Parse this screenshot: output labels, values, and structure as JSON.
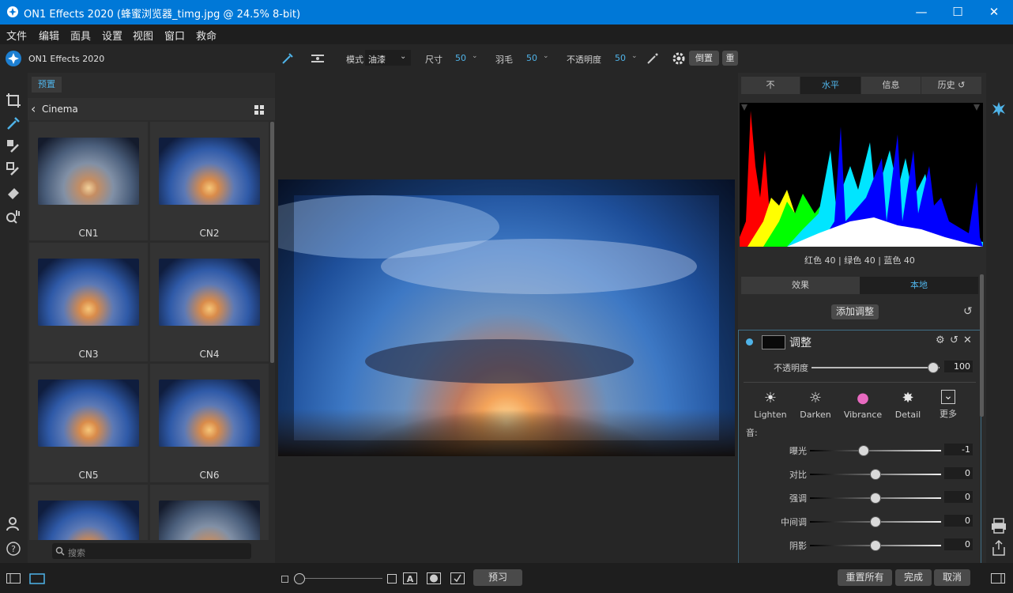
{
  "window": {
    "title": "ON1 Effects 2020 (蜂蜜浏览器_timg.jpg @ 24.5% 8-bit)",
    "minimize": "—",
    "maximize": "☐",
    "close": "✕"
  },
  "menubar": [
    "文件",
    "编辑",
    "面具",
    "设置",
    "视图",
    "窗口",
    "救命"
  ],
  "app_name": "ON1 Effects 2020",
  "toolbar": {
    "mode_label": "模式",
    "mode_value": "油漆",
    "size_label": "尺寸",
    "size_value": "50",
    "feather_label": "羽毛",
    "feather_value": "50",
    "opacity_label": "不透明度",
    "opacity_value": "50",
    "invert_button": "倒置",
    "extra_button": "重"
  },
  "left_panel": {
    "tab": "预置",
    "breadcrumb": "Cinema",
    "thumbnails": [
      "CN1",
      "CN2",
      "CN3",
      "CN4",
      "CN5",
      "CN6"
    ],
    "search_placeholder": "搜索"
  },
  "right_panel": {
    "tabs": [
      "不",
      "水平",
      "信息",
      "历史 ↺"
    ],
    "active_tab": 1,
    "rgb_readout": "红色   40  | 绿色   40  | 蓝色   40",
    "sub_tabs": [
      "效果",
      "本地"
    ],
    "active_sub_tab": 1,
    "add_adjust_button": "添加调整",
    "adjust": {
      "title": "调整",
      "opacity_label": "不透明度",
      "opacity_value": "100",
      "opacity_fraction": 0.95,
      "presets": [
        {
          "icon": "lighten-sun-icon",
          "glyph": "☀",
          "label": "Lighten"
        },
        {
          "icon": "darken-sun-icon",
          "glyph": "☼",
          "label": "Darken"
        },
        {
          "icon": "vibrance-icon",
          "glyph": "●",
          "label": "Vibrance"
        },
        {
          "icon": "detail-icon",
          "glyph": "✸",
          "label": "Detail"
        },
        {
          "icon": "more-chevron-icon",
          "glyph": "⌄",
          "label": "更多"
        }
      ],
      "tone_label": "音:",
      "sliders": [
        {
          "label": "曝光",
          "value": "-1",
          "fraction": 0.41
        },
        {
          "label": "对比",
          "value": "0",
          "fraction": 0.5
        },
        {
          "label": "强调",
          "value": "0",
          "fraction": 0.5
        },
        {
          "label": "中间调",
          "value": "0",
          "fraction": 0.5
        },
        {
          "label": "阴影",
          "value": "0",
          "fraction": 0.5
        }
      ]
    }
  },
  "bottom": {
    "preview_button": "预习",
    "reset_all_button": "重置所有",
    "done_button": "完成",
    "cancel_button": "取消"
  },
  "colors": {
    "accent": "#4fb3e8",
    "titlebar": "#0078d7",
    "panel": "#2b2b2b"
  }
}
